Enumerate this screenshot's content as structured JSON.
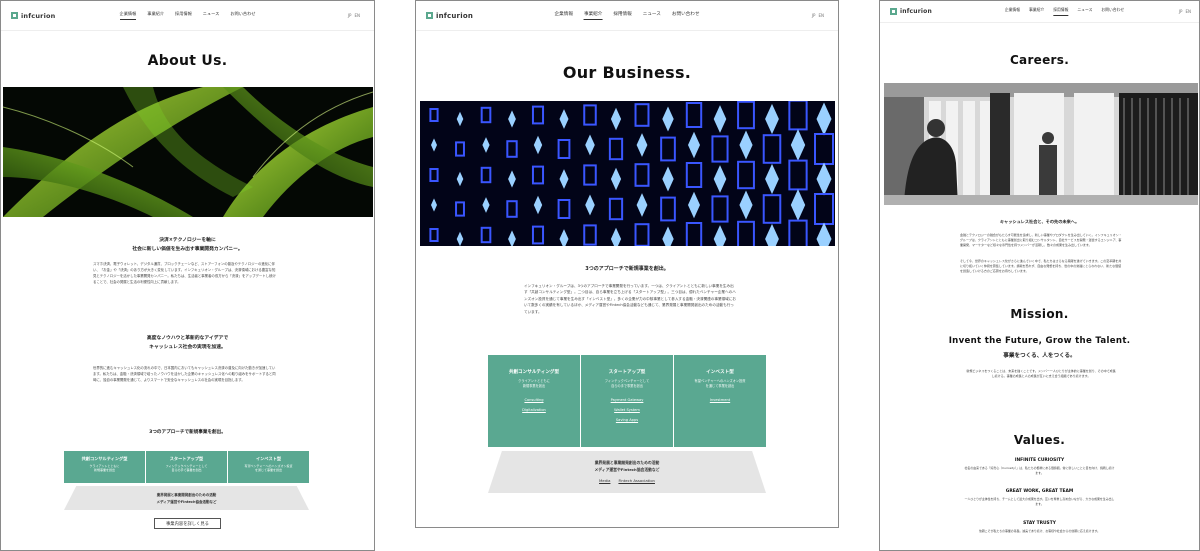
{
  "logo": {
    "text": "infcurion"
  },
  "nav": [
    "企業情報",
    "事業紹介",
    "採用情報",
    "ニュース",
    "お問い合わせ"
  ],
  "lang": {
    "ja": "JP",
    "en": "EN"
  },
  "about": {
    "title": "About Us.",
    "heading1": "決済×テクノロジーを軸に",
    "heading2": "社会に新しい価値を生み出す事業開発カンパニー。",
    "para": "スマホ決済、電子ウォレット、デジタル通貨、ブロックチェーンなど、ストアーフォンの普及やテクノロジーの進化に伴い、「お金」や「決済」のあり方が大きく変化しています。インフキュリオン・グループは、決済領域における豊富な知見とテクノロジーを活かした事業開発カンパニー。私たちは、生活者と事業者の双方から「決済」をアップデートし続けることで、社会の発展と生活の利便性向上に貢献します。",
    "heading3": "高度なノウハウと革新的なアイデアで",
    "heading4": "キャッシュレス社会の実現を加速。",
    "para2": "世界的に進むキャッシュレス化の流れの中で、日本国内においてもキャッシュレス決済の普及に向けた動きが加速しています。私たちは、金融・決済領域で培ったノウハウを活かした企業のキャッシュレス化への取り組みをサポートすると同時に、独自の事業開発を通じて、よりスマートで安全なキャッシュレスの社会の実現を目指します。",
    "approach": "3つのアプローチで新規事業を創出。",
    "cards": [
      {
        "title": "共創コンサルティング型",
        "sub1": "クライアントとともに",
        "sub2": "新規事業を創出"
      },
      {
        "title": "スタートアップ型",
        "sub1": "フィンテックベンチャーとして",
        "sub2": "自らの手で事業を創出"
      },
      {
        "title": "インベスト型",
        "sub1": "有望ベンチャーへのハンズオン投資",
        "sub2": "を通じて事業を創出"
      }
    ],
    "trap1": "業界発展と事業開発創出のための活動",
    "trap2": "メディア運営やFintech協会活動など",
    "button": "事業内容を詳しく見る"
  },
  "business": {
    "title": "Our Business.",
    "approach": "3つのアプローチで新規事業を創出。",
    "para": "インフキュリオン・グループは、3つのアプローチで事業開発を行っています。一つは、クライアントとともに新しい事業を生み出す「共創コンサルティング型」。二つ目は、自ら事業を立ち上げる「スタートアップ型」。三つ目は、優れたベンチャー企業へのハンズオン投資を通じて事業を生み出す「インベスト型」。多くの企業が力の中核事業として参入する金融・決済関連の事業領域において数多くの実績を有しているほか、メディア運営やFintech協会活動なども通じて、業界発展と事業開発創出のための活動も行っています。",
    "cards": [
      {
        "title": "共創コンサルティング型",
        "sub1": "クライアントとともに",
        "sub2": "新規事業を創出",
        "links": [
          "Consulting",
          "Digitalization"
        ]
      },
      {
        "title": "スタートアップ型",
        "sub1": "フィンテックベンチャーとして",
        "sub2": "自らの手で事業を創出",
        "links": [
          "Payment Gateway",
          "Wallet System",
          "Saving Apps"
        ]
      },
      {
        "title": "インベスト型",
        "sub1": "有望ベンチャーへのハンズオン投資",
        "sub2": "を通じて事業を創出",
        "links": [
          "Investment"
        ]
      }
    ],
    "trap1": "業界発展と事業開発創出のための活動",
    "trap2": "メディア運営やFintech協会活動など",
    "trap_links": [
      "Media",
      "Fintech Association"
    ]
  },
  "careers": {
    "title": "Careers.",
    "heading": "キャッシュレス社会と、その先の未来へ。",
    "para": "金融とテクノロジーの融合がもたらす可能性を追求し、新しい事業やプロダクトを生み出していく。インフキュリオン・グループは、クライアントとともに事業創出に取り組むコンサルタント、自社サービスを開発・運営するエンジニア、事業開発、マーケターなど様々な専門性を持つメンバーが活躍し、数々の成果を生み出しています。",
    "para2": "そして今、世界のキャッシュレス化がさらに進んでいく中で、私たちはさらなる飛躍を遂げていきます。この変革期を共に切り拓いていく仲間を募集しています。挑戦を恐れず、自由な発想を持ち、世の中の常識にとらわれない、新たな価値を創造していける方のご応募をお待ちしています。",
    "mission_title": "Mission.",
    "mission_en": "Invent the Future, Grow the Talent.",
    "mission_jp": "事業をつくる、人をつくる。",
    "mission_para": "新規ビジネスをつくることは、未来を描くことです。メンバー一人ひとりが主体的に事業を創り、その中で成長し続ける。事業の成長と人の成長が互いに支え合う組織であり続けます。",
    "values_title": "Values.",
    "values": [
      {
        "name": "INFINITE CURIOSITY",
        "desc": "社名の由来である「好奇心（Curiosity）」は、私たちの根幹にある価値観。常に新しいことに目を向け、挑戦し続けます。"
      },
      {
        "name": "GREAT WORK, GREAT TEAM",
        "desc": "一人ひとりが主体性を持ち、チームとして最大の成果を出す。互いを尊重し高め合いながら、大きな成果を生み出します。"
      },
      {
        "name": "STAY TRUSTY",
        "desc": "信頼こそが私たちの事業の基盤。誠実であり続け、お客様や社会からの信頼に応え続けます。"
      }
    ]
  }
}
